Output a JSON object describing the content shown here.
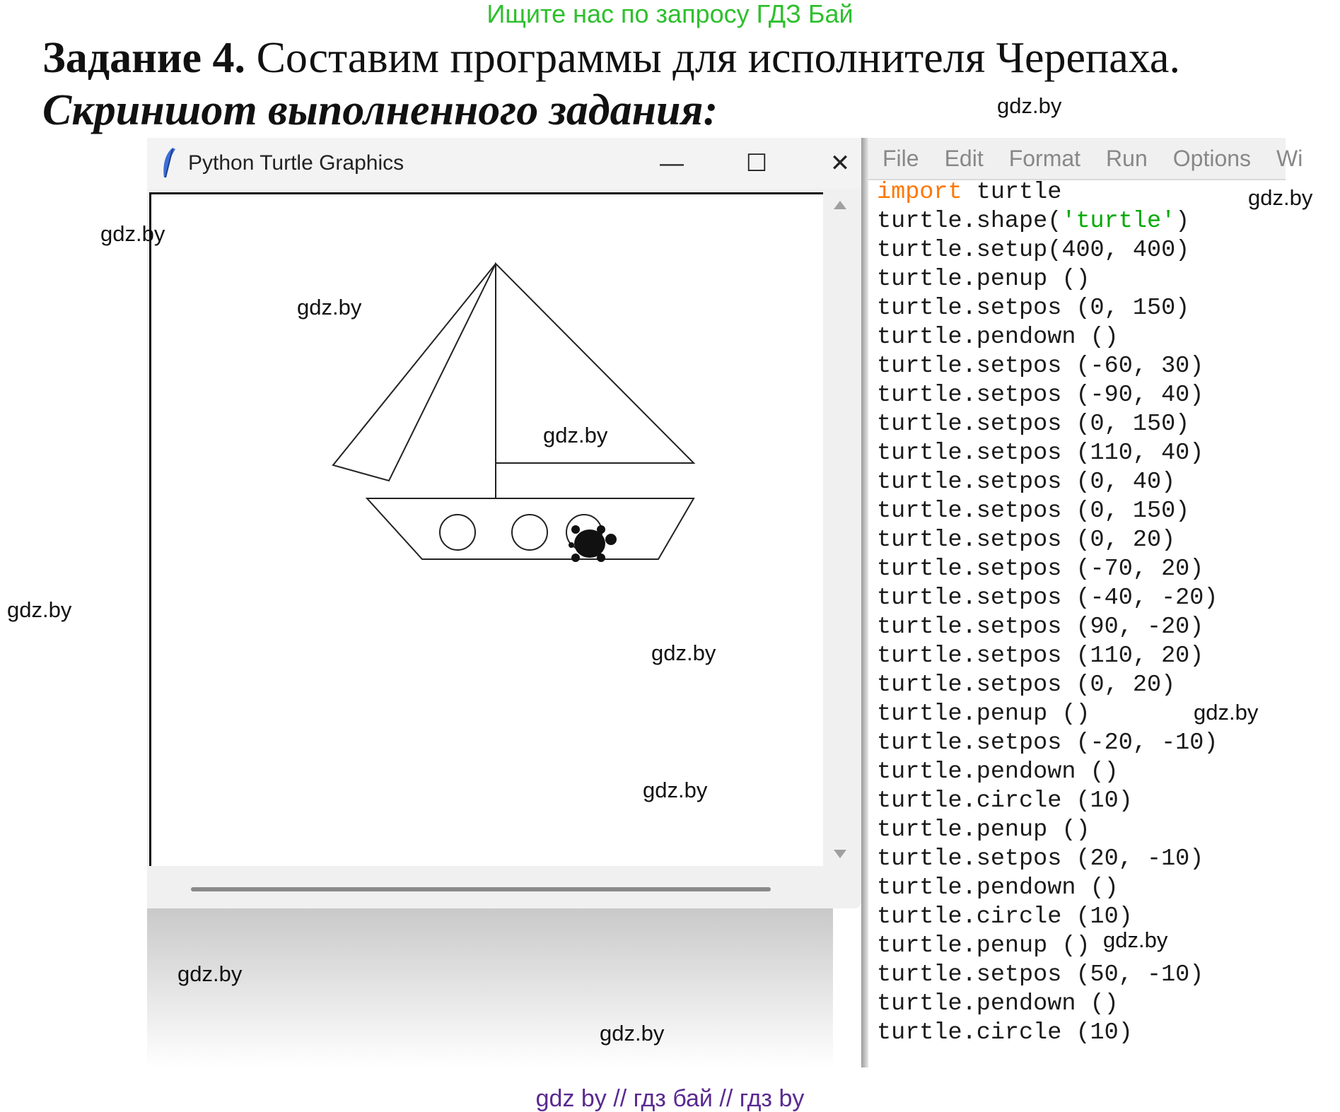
{
  "header": {
    "banner": "Ищите нас по запросу ГДЗ Бай",
    "task_bold": "Задание 4.",
    "task_text": " Составим программы для исполнителя Черепаха.",
    "subtitle": "Скриншот выполненного задания:"
  },
  "turtle_window": {
    "title": "Python Turtle Graphics",
    "icon": "feather-icon",
    "minimize": "—",
    "maximize": "☐",
    "close": "✕"
  },
  "editor": {
    "menu": [
      "File",
      "Edit",
      "Format",
      "Run",
      "Options",
      "Wi"
    ],
    "code_lines": [
      "import turtle",
      "turtle.shape('turtle')",
      "turtle.setup(400, 400)",
      "turtle.penup ()",
      "turtle.setpos (0, 150)",
      "turtle.pendown ()",
      "turtle.setpos (-60, 30)",
      "turtle.setpos (-90, 40)",
      "turtle.setpos (0, 150)",
      "turtle.setpos (110, 40)",
      "turtle.setpos (0, 40)",
      "turtle.setpos (0, 150)",
      "turtle.setpos (0, 20)",
      "turtle.setpos (-70, 20)",
      "turtle.setpos (-40, -20)",
      "turtle.setpos (90, -20)",
      "turtle.setpos (110, 20)",
      "turtle.setpos (0, 20)",
      "turtle.penup ()",
      "turtle.setpos (-20, -10)",
      "turtle.pendown ()",
      "turtle.circle (10)",
      "turtle.penup ()",
      "turtle.setpos (20, -10)",
      "turtle.pendown ()",
      "turtle.circle (10)",
      "turtle.penup ()",
      "turtle.setpos (50, -10)",
      "turtle.pendown ()",
      "turtle.circle (10)"
    ]
  },
  "watermarks": [
    "gdz.by",
    "gdz.by",
    "gdz.by",
    "gdz.by",
    "gdz.by",
    "gdz.by",
    "gdz.by",
    "gdz.by",
    "gdz.by",
    "gdz.by",
    "gdz.by",
    "gdz.by"
  ],
  "footer": "gdz by  //  гдз бай  //  гдз by"
}
